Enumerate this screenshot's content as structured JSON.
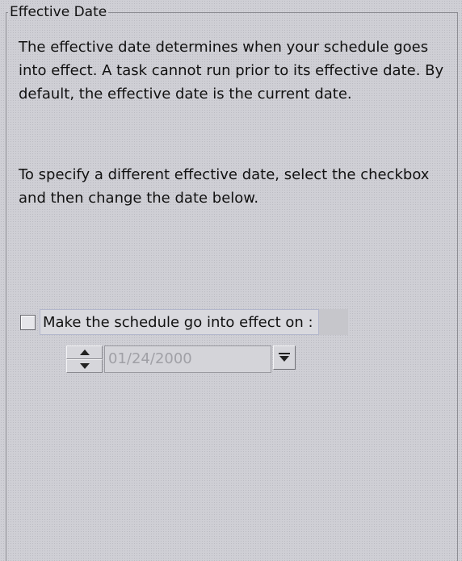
{
  "groupbox": {
    "title": "Effective Date"
  },
  "description": {
    "paragraph1": "The effective date determines when your schedule goes into effect. A task cannot run prior to its effective date. By default, the effective date is the current date.",
    "paragraph2": "To specify a different effective date, select the checkbox and then change the date below."
  },
  "effective_checkbox": {
    "label": "Make the schedule go into effect on :",
    "checked": false
  },
  "date_picker": {
    "value": "01/24/2000",
    "enabled": false
  },
  "icons": {
    "spin_up": "triangle-up-icon",
    "spin_down": "triangle-down-icon",
    "dropdown": "chevron-down-icon"
  }
}
